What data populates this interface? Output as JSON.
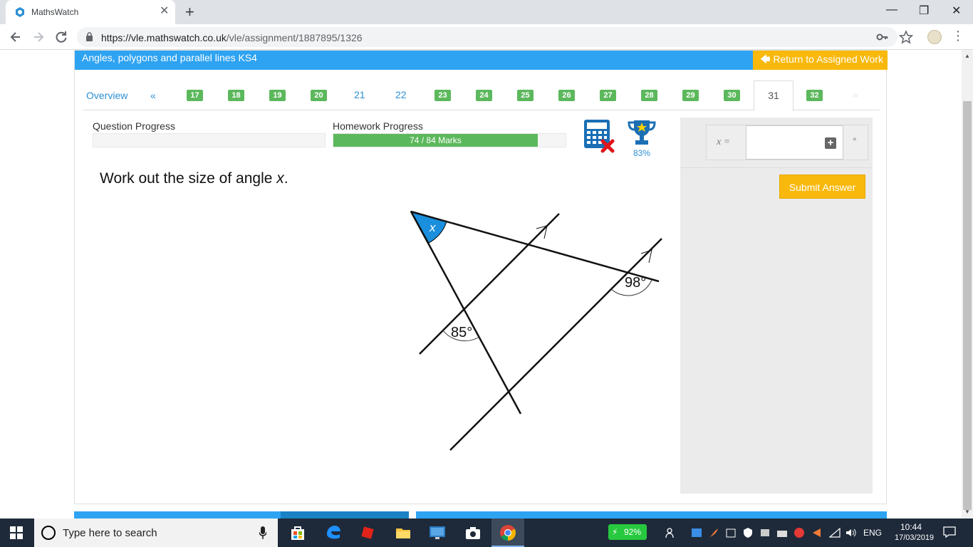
{
  "browser": {
    "tab_title": "MathsWatch",
    "tab_close": "✕",
    "new_tab": "+",
    "window_minimize": "—",
    "window_restore": "❐",
    "window_close": "✕",
    "url_host": "https://vle.mathswatch.co.uk",
    "url_path": "/vle/assignment/1887895/1326",
    "menu": "⋮"
  },
  "page": {
    "topic_title": "Angles, polygons and parallel lines KS4",
    "return_label": "Return to Assigned Work",
    "nav": {
      "overview": "Overview",
      "prev": "«",
      "next": "»",
      "questions": [
        {
          "n": "17",
          "state": "done"
        },
        {
          "n": "18",
          "state": "done"
        },
        {
          "n": "19",
          "state": "done"
        },
        {
          "n": "20",
          "state": "done"
        },
        {
          "n": "21",
          "state": "todo"
        },
        {
          "n": "22",
          "state": "todo"
        },
        {
          "n": "23",
          "state": "done"
        },
        {
          "n": "24",
          "state": "done"
        },
        {
          "n": "25",
          "state": "done"
        },
        {
          "n": "26",
          "state": "done"
        },
        {
          "n": "27",
          "state": "done"
        },
        {
          "n": "28",
          "state": "done"
        },
        {
          "n": "29",
          "state": "done"
        },
        {
          "n": "30",
          "state": "done"
        },
        {
          "n": "31",
          "state": "active"
        },
        {
          "n": "32",
          "state": "done"
        }
      ]
    },
    "question_progress": {
      "label": "Question Progress",
      "fraction": 0.0
    },
    "homework_progress": {
      "label": "Homework Progress",
      "text": "74 / 84 Marks",
      "fraction": 0.88
    },
    "trophy_percent": "83%",
    "question": {
      "prefix": "Work out the size of angle ",
      "variable": "x",
      "suffix": "."
    },
    "diagram": {
      "angle_x_label": "x",
      "angle_a_label": "85°",
      "angle_b_label": "98°"
    },
    "answer": {
      "variable": "x =",
      "unit": "°",
      "plus": "+"
    },
    "submit_label": "Submit Answer"
  },
  "taskbar": {
    "search_placeholder": "Type here to search",
    "battery": "92%",
    "language": "ENG",
    "time": "10:44",
    "date": "17/03/2019"
  },
  "colors": {
    "accent_blue": "#2ea3f2",
    "success_green": "#5cb85c",
    "warning_yellow": "#f8b80c"
  }
}
